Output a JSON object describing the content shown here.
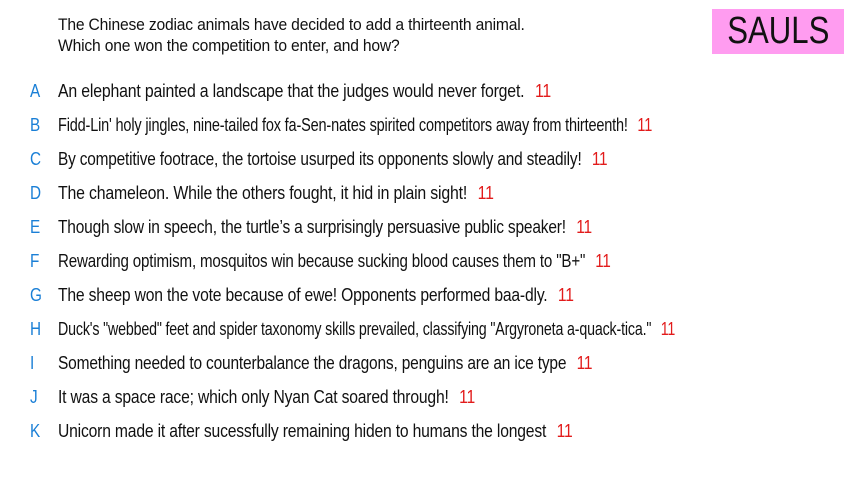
{
  "question": {
    "line1": "The Chinese zodiac animals have decided to add a thirteenth animal.",
    "line2": "Which one won the competition to enter, and how?"
  },
  "badge": {
    "label": "SAULS",
    "color": "#ff9cf0"
  },
  "colors": {
    "letter": "#1a7fd6",
    "score": "#e21b1b",
    "text": "#111111"
  },
  "answers": [
    {
      "letter": "A",
      "text": "An elephant painted a landscape that the judges would never forget.",
      "score": "11"
    },
    {
      "letter": "B",
      "text": "Fidd-Lin' holy jingles, nine-tailed fox fa-Sen-nates spirited competitors away from thirteenth!",
      "score": "11"
    },
    {
      "letter": "C",
      "text": "By competitive footrace, the tortoise usurped its opponents slowly and steadily!",
      "score": "11"
    },
    {
      "letter": "D",
      "text": "The chameleon. While the others fought, it hid in plain sight!",
      "score": "11"
    },
    {
      "letter": "E",
      "text": "Though slow in speech, the turtle’s a surprisingly persuasive public speaker!",
      "score": "11"
    },
    {
      "letter": "F",
      "text": "Rewarding optimism, mosquitos win because sucking blood causes them to \"B+\"",
      "score": "11"
    },
    {
      "letter": "G",
      "text": "The sheep won the vote because of ewe! Opponents performed baa-dly.",
      "score": "11"
    },
    {
      "letter": "H",
      "text": "Duck's \"webbed\" feet and spider taxonomy skills prevailed, classifying \"Argyroneta a-quack-tica.\"",
      "score": "11"
    },
    {
      "letter": "I",
      "text": "Something needed to counterbalance the dragons, penguins are an ice type",
      "score": "11"
    },
    {
      "letter": "J",
      "text": "It was a space race; which only Nyan Cat soared through!",
      "score": "11"
    },
    {
      "letter": "K",
      "text": "Unicorn made it after sucessfully remaining hiden to humans the longest",
      "score": "11"
    }
  ]
}
